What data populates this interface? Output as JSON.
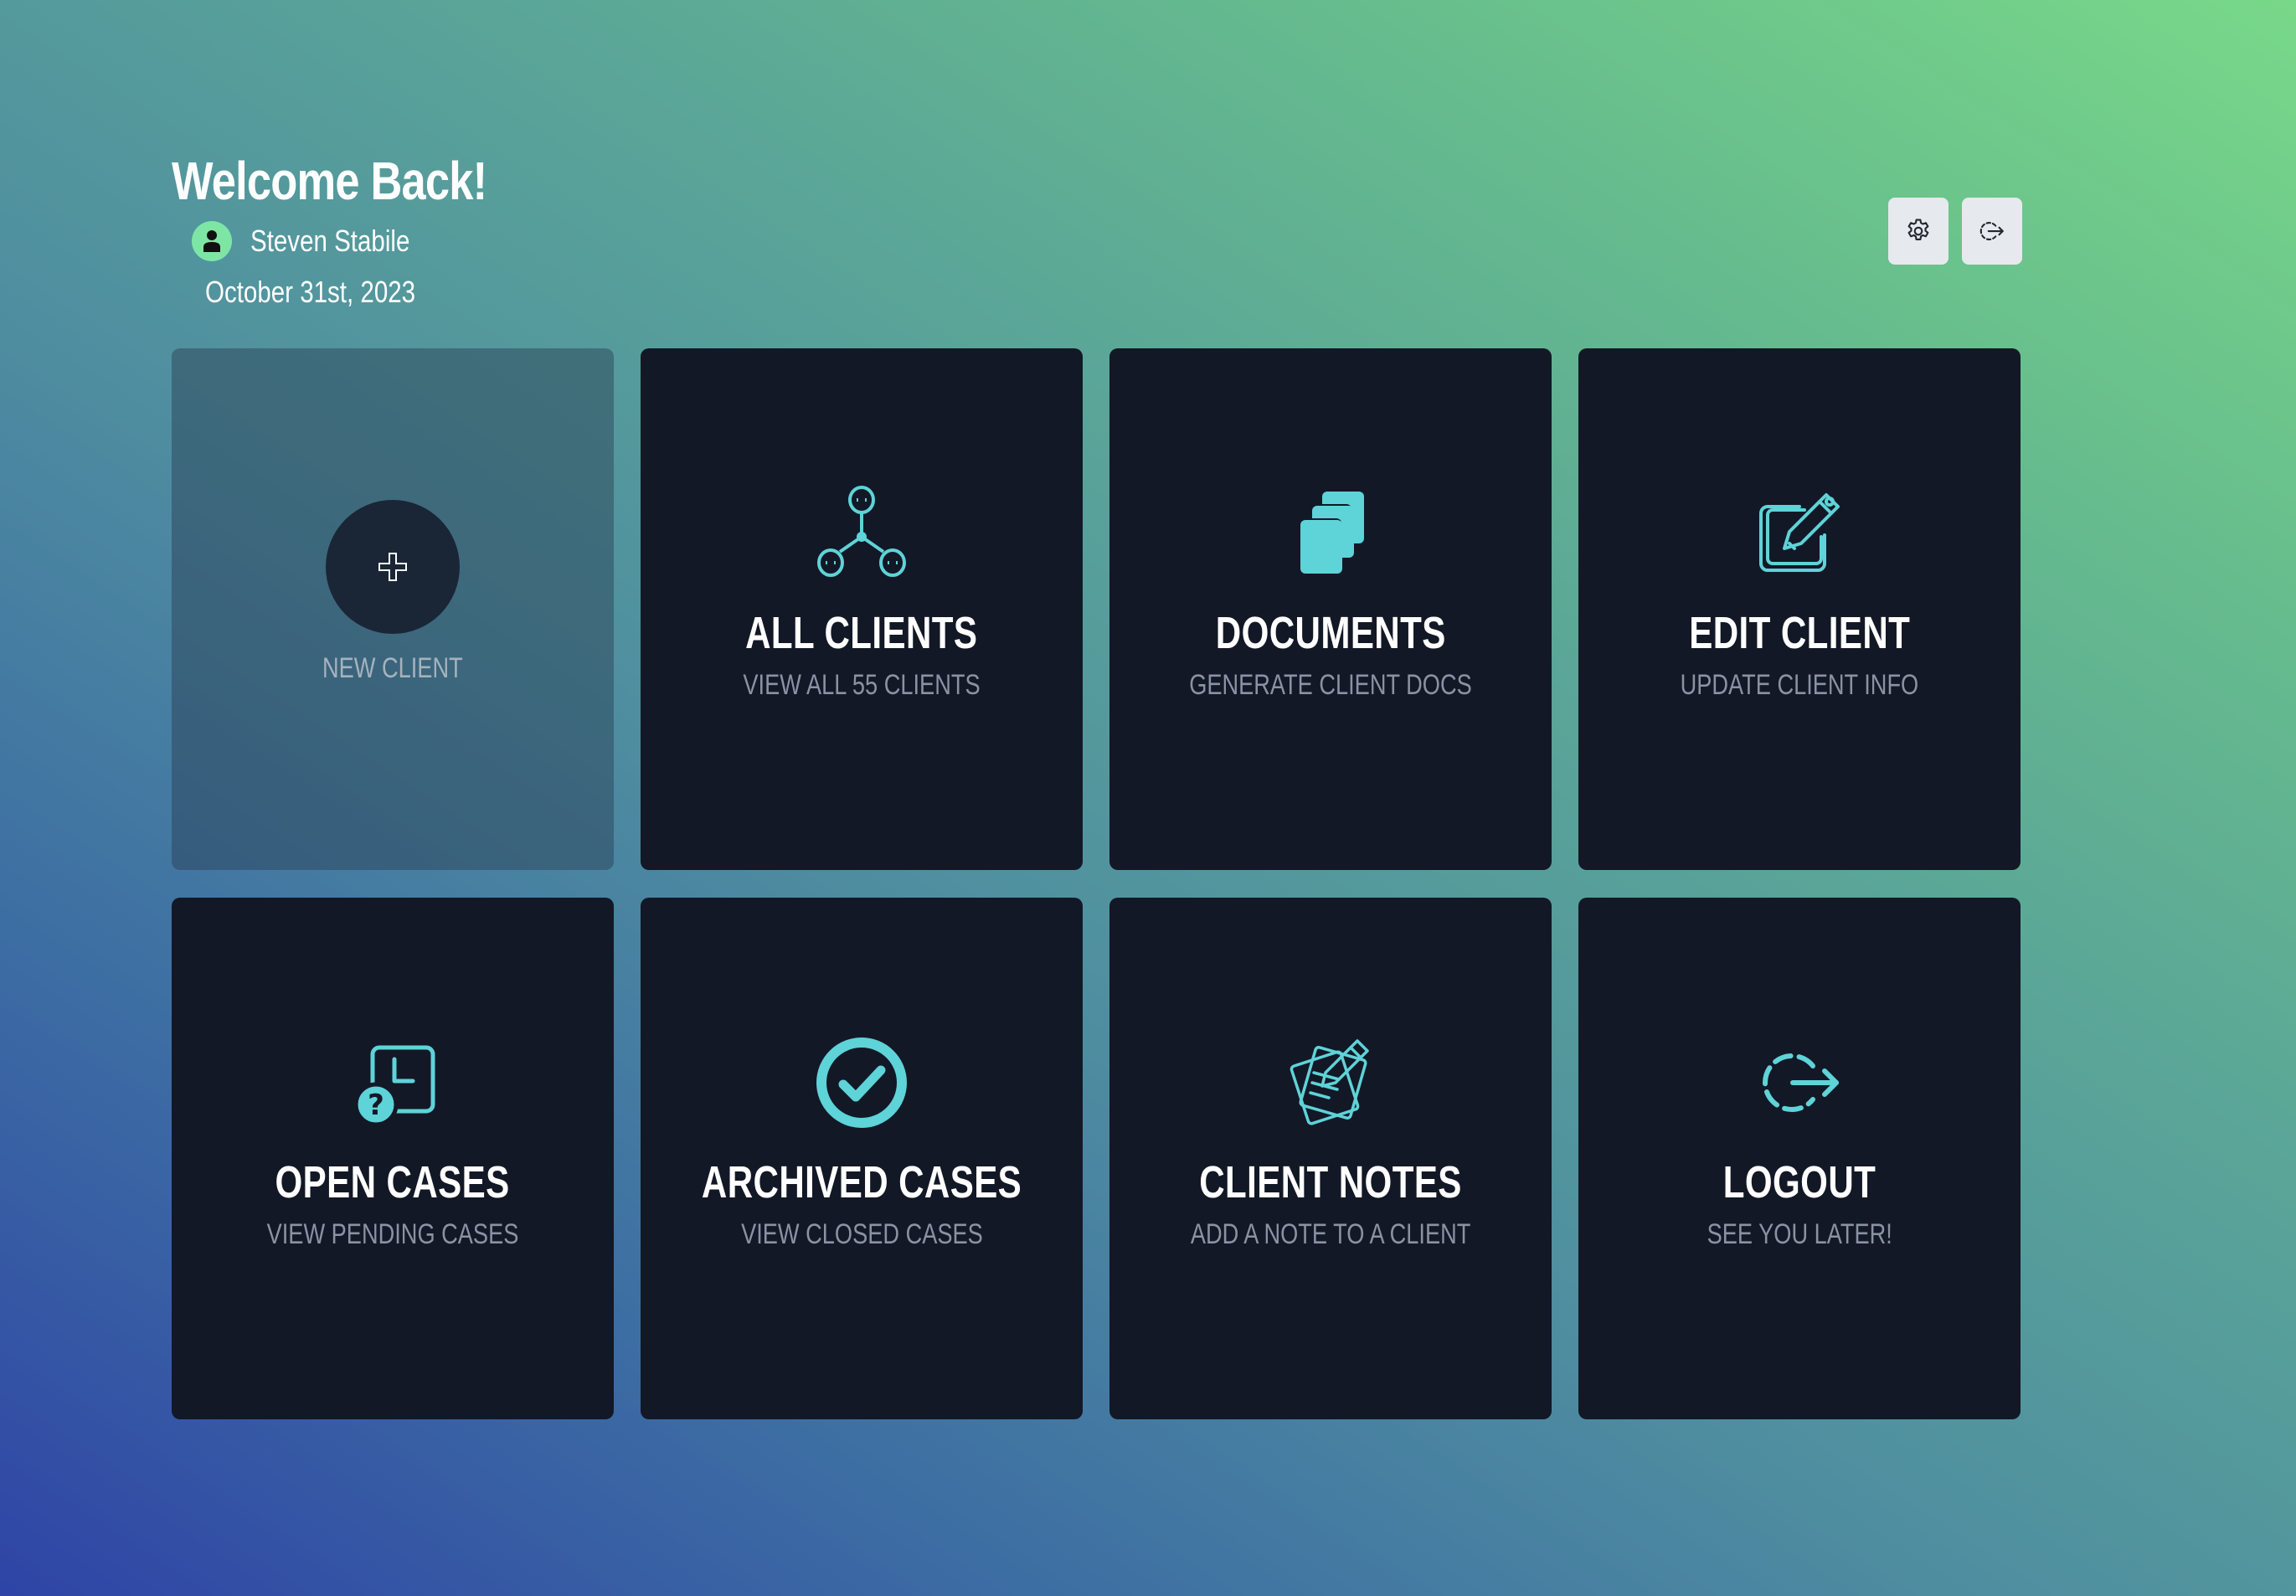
{
  "header": {
    "welcome": "Welcome Back!",
    "user_name": "Steven Stabile",
    "date": "October 31st, 2023",
    "settings_icon": "gear-icon",
    "logout_icon": "logout-icon"
  },
  "tiles": {
    "new_client": {
      "label": "NEW CLIENT",
      "icon": "plus-icon"
    },
    "all_clients": {
      "title": "ALL CLIENTS",
      "subtitle": "VIEW ALL 55 CLIENTS",
      "icon": "network-users-icon"
    },
    "documents": {
      "title": "DOCUMENTS",
      "subtitle": "GENERATE CLIENT DOCS",
      "icon": "documents-stack-icon"
    },
    "edit_client": {
      "title": "EDIT CLIENT",
      "subtitle": "UPDATE CLIENT INFO",
      "icon": "edit-pencil-icon"
    },
    "open_cases": {
      "title": "OPEN CASES",
      "subtitle": "VIEW PENDING CASES",
      "icon": "pending-clock-icon"
    },
    "archived_cases": {
      "title": "ARCHIVED CASES",
      "subtitle": "VIEW CLOSED CASES",
      "icon": "check-circle-icon"
    },
    "client_notes": {
      "title": "CLIENT NOTES",
      "subtitle": "ADD A NOTE TO A CLIENT",
      "icon": "notes-icon"
    },
    "logout": {
      "title": "LOGOUT",
      "subtitle": "SEE YOU LATER!",
      "icon": "logout-icon"
    }
  },
  "colors": {
    "accent": "#5ed3d8",
    "card_bg": "#131826",
    "subtitle": "#8a93a3",
    "avatar": "#7ee6a4"
  }
}
